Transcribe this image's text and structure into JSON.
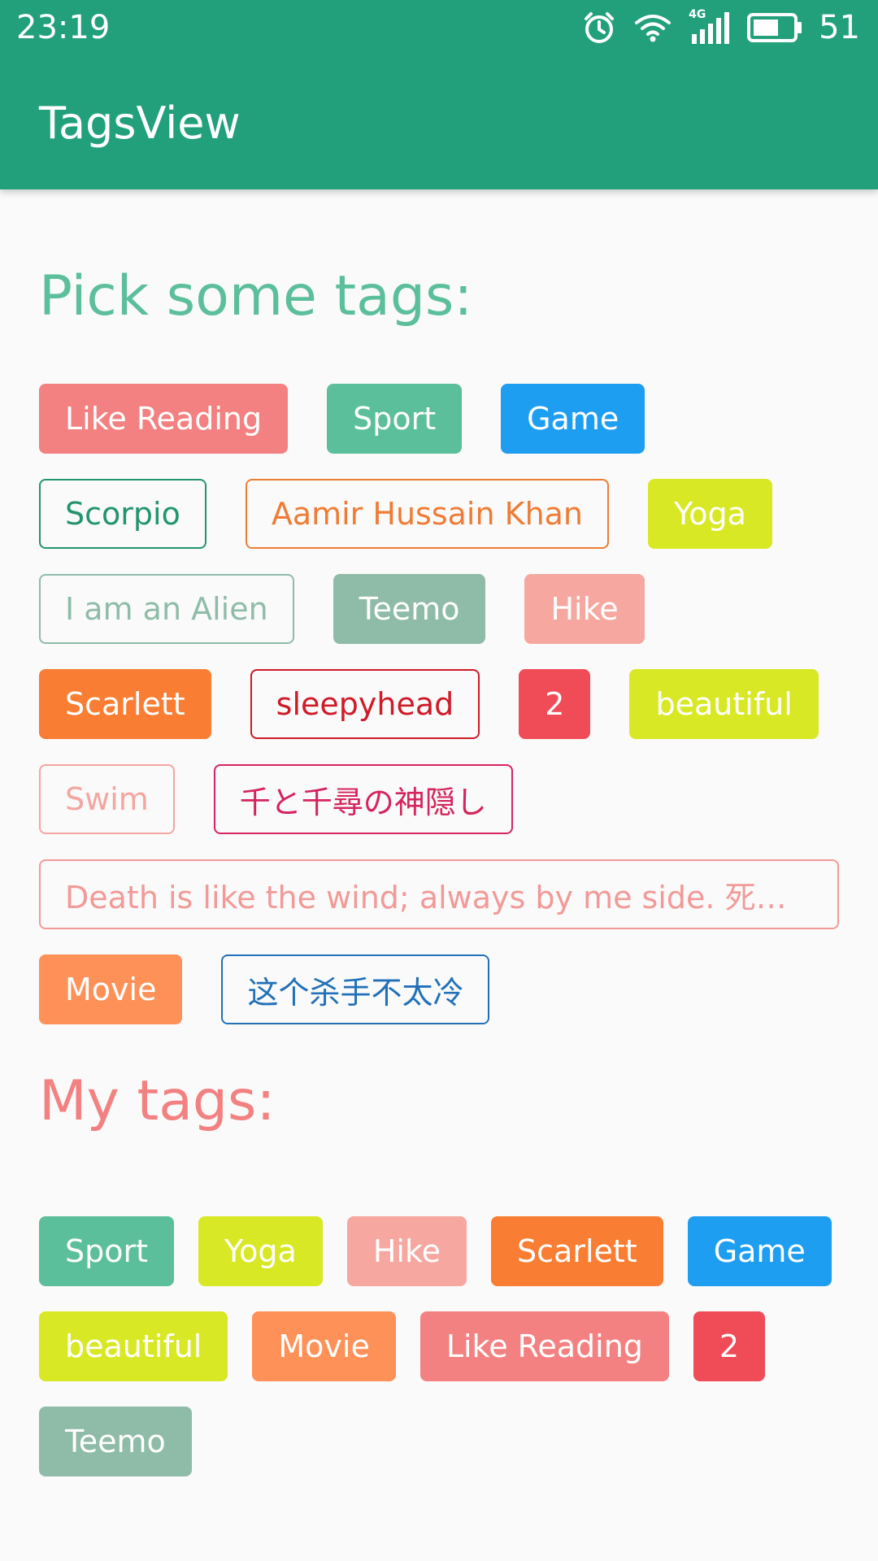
{
  "status_bar": {
    "time": "23:19",
    "network_label": "4G",
    "battery": "51",
    "icons": [
      "alarm-icon",
      "wifi-icon",
      "signal-icon",
      "battery-icon"
    ]
  },
  "app_bar": {
    "title": "TagsView",
    "background": "#22a07c"
  },
  "pick_section": {
    "title": "Pick some tags:",
    "title_color": "#5cbf9b",
    "tags": [
      {
        "label": "Like Reading",
        "style": "filled",
        "color": "#f38181"
      },
      {
        "label": "Sport",
        "style": "filled",
        "color": "#5cbf9b"
      },
      {
        "label": "Game",
        "style": "filled",
        "color": "#1e9ef0"
      },
      {
        "label": "Scorpio",
        "style": "outlined",
        "color": "#22956e"
      },
      {
        "label": "Aamir Hussain Khan",
        "style": "outlined",
        "color": "#ee7c35"
      },
      {
        "label": "Yoga",
        "style": "filled",
        "color": "#d9e825"
      },
      {
        "label": "I am an Alien",
        "style": "outlined",
        "color": "#8fbca8"
      },
      {
        "label": "Teemo",
        "style": "filled",
        "color": "#8fbba9"
      },
      {
        "label": "Hike",
        "style": "filled",
        "color": "#f6a7a0"
      },
      {
        "label": "Scarlett",
        "style": "filled",
        "color": "#f97d32"
      },
      {
        "label": "sleepyhead",
        "style": "outlined",
        "color": "#cf1a28"
      },
      {
        "label": "2",
        "style": "filled",
        "color": "#ef4c58"
      },
      {
        "label": "beautiful",
        "style": "filled",
        "color": "#d9e825"
      },
      {
        "label": "Swim",
        "style": "outlined",
        "color": "#f4a6a0"
      },
      {
        "label": "千と千尋の神隠し",
        "style": "outlined",
        "color": "#d6245d"
      },
      {
        "label": "Death is like the wind; always by me side. 死亡…",
        "style": "outlined",
        "color": "#f19a98",
        "long": true
      },
      {
        "label": "Movie",
        "style": "filled",
        "color": "#fd9157"
      },
      {
        "label": "这个杀手不太冷",
        "style": "outlined",
        "color": "#2271b8"
      }
    ]
  },
  "my_section": {
    "title": "My tags:",
    "title_color": "#f38181",
    "tags": [
      {
        "label": "Sport",
        "style": "filled",
        "color": "#5cbf9b"
      },
      {
        "label": "Yoga",
        "style": "filled",
        "color": "#d9e825"
      },
      {
        "label": "Hike",
        "style": "filled",
        "color": "#f6a7a0"
      },
      {
        "label": "Scarlett",
        "style": "filled",
        "color": "#f97d32"
      },
      {
        "label": "Game",
        "style": "filled",
        "color": "#1e9ef0"
      },
      {
        "label": "beautiful",
        "style": "filled",
        "color": "#d9e825"
      },
      {
        "label": "Movie",
        "style": "filled",
        "color": "#fd9157"
      },
      {
        "label": "Like Reading",
        "style": "filled",
        "color": "#f38181"
      },
      {
        "label": "2",
        "style": "filled",
        "color": "#ef4c58"
      },
      {
        "label": "Teemo",
        "style": "filled",
        "color": "#8fbba9"
      }
    ]
  }
}
